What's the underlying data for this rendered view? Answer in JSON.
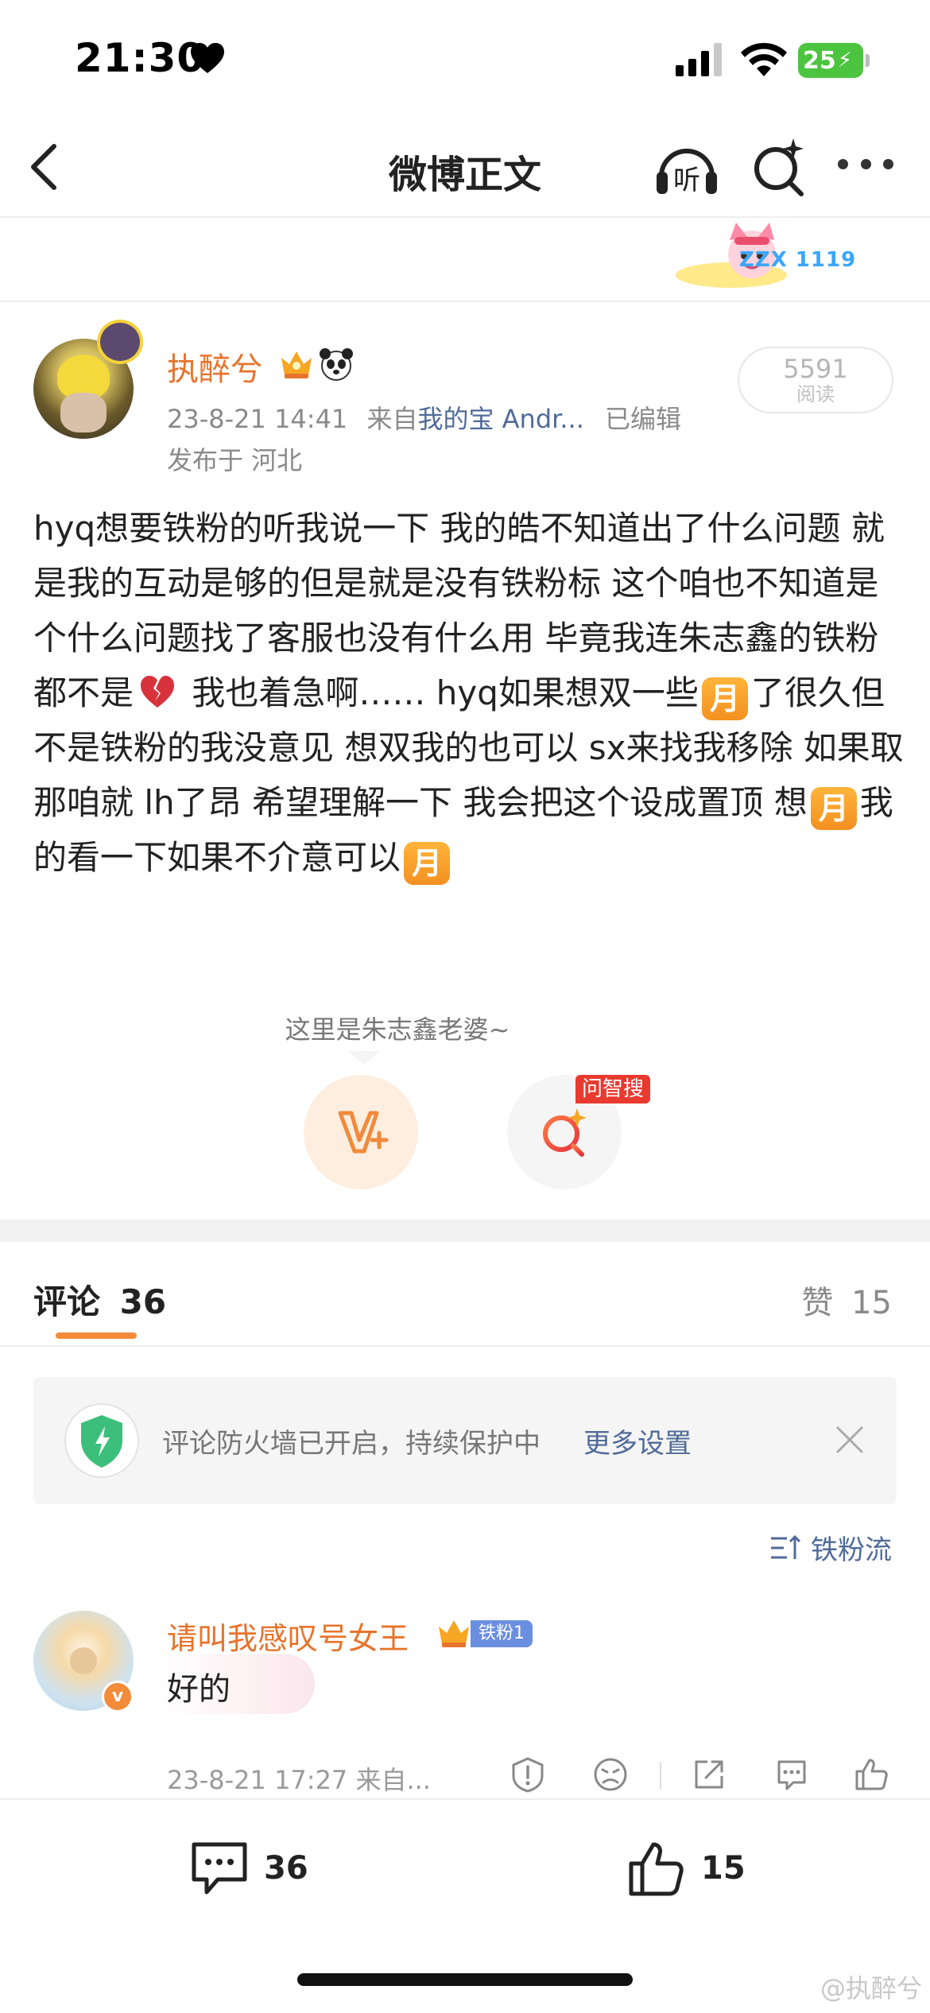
{
  "status_bar": {
    "time": "21:30",
    "battery": "25"
  },
  "nav": {
    "title": "微博正文",
    "listen_label": "听"
  },
  "banner": {
    "text": "ZZX 1119"
  },
  "post": {
    "username": "执醉兮",
    "timestamp": "23-8-21 14:41",
    "source_prefix": "来自",
    "source": "我的宝 Andr...",
    "edited": "已编辑",
    "location": "发布于 河北",
    "read_count": "5591",
    "read_label": "阅读",
    "body": {
      "p1": "hyq想要铁粉的听我说一下 我的皓不知道出了什么问题 就是我的互动是够的但是就是没有铁粉标 这个咱也不知道是个什么问题找了客服也没有什么用 毕竟我连朱志鑫的铁粉都不是",
      "p2": " 我也着急啊…… hyq如果想双一些",
      "p3": "了很久但不是铁粉的我没意见 想双我的也可以 sx来找我移除 如果取那咱就 lh了昂 希望理解一下 我会把这个设成置顶 想",
      "p4": "我的看一下如果不介意可以",
      "emoji_month": "月"
    },
    "sticker_caption": "这里是朱志鑫老婆~",
    "ask_badge": "问智搜"
  },
  "comments_tab": {
    "label": "评论",
    "count": "36",
    "likes_label": "赞",
    "likes_count": "15"
  },
  "firewall": {
    "text": "评论防火墙已开启，持续保护中",
    "link": "更多设置"
  },
  "sort": {
    "label": "铁粉流"
  },
  "comments": [
    {
      "name": "请叫我感叹号女王",
      "fan_badge": "铁粉1",
      "text": "好的",
      "meta": "23-8-21 17:27  来自..."
    }
  ],
  "bottom_bar": {
    "comment_count": "36",
    "like_count": "15"
  },
  "watermark": "@执醉兮",
  "colors": {
    "accent_orange": "#e8732b",
    "link_blue": "#506b99",
    "badge_red": "#e83a2f",
    "shield_green": "#3cbf7a"
  },
  "icons": [
    "heart-icon",
    "signal-icon",
    "wifi-icon",
    "battery-icon",
    "back-icon",
    "listen-icon",
    "ai-search-icon",
    "more-icon",
    "vip-crown-icon",
    "panda-icon",
    "broken-heart-icon",
    "charge-icon",
    "shield-icon",
    "close-icon",
    "sort-icon",
    "report-icon",
    "dislike-icon",
    "share-icon",
    "reply-icon",
    "like-icon",
    "comment-icon"
  ]
}
